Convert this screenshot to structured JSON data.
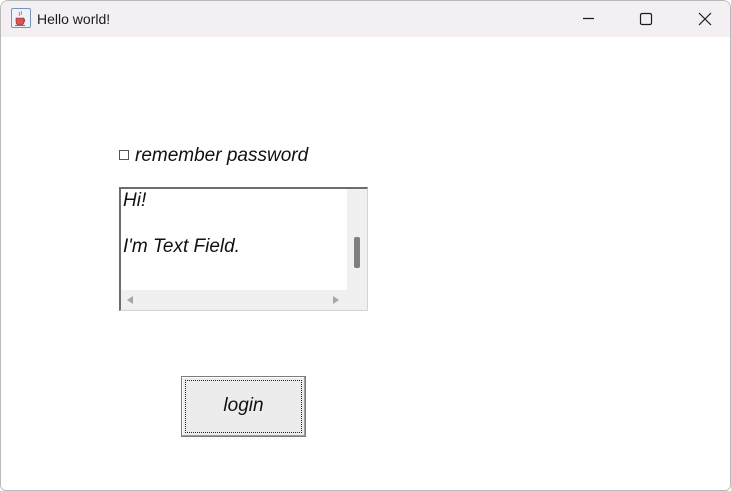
{
  "window": {
    "title": "Hello world!",
    "app_icon": "java-cup-icon",
    "controls": {
      "minimize_icon": "minimize-icon",
      "maximize_icon": "maximize-icon",
      "close_icon": "close-icon"
    }
  },
  "form": {
    "remember_checkbox": {
      "label": "remember password",
      "checked": false
    },
    "text_area": {
      "lines": [
        "Hi!",
        "",
        "I'm Text Field."
      ]
    },
    "login_button": {
      "label": "login"
    }
  },
  "colors": {
    "titlebar_bg": "#f3eff3",
    "window_bg": "#ffffff",
    "scrollbar_track": "#f0f0f0",
    "scrollbar_thumb": "#7f7f7f",
    "button_face": "#ececec"
  }
}
